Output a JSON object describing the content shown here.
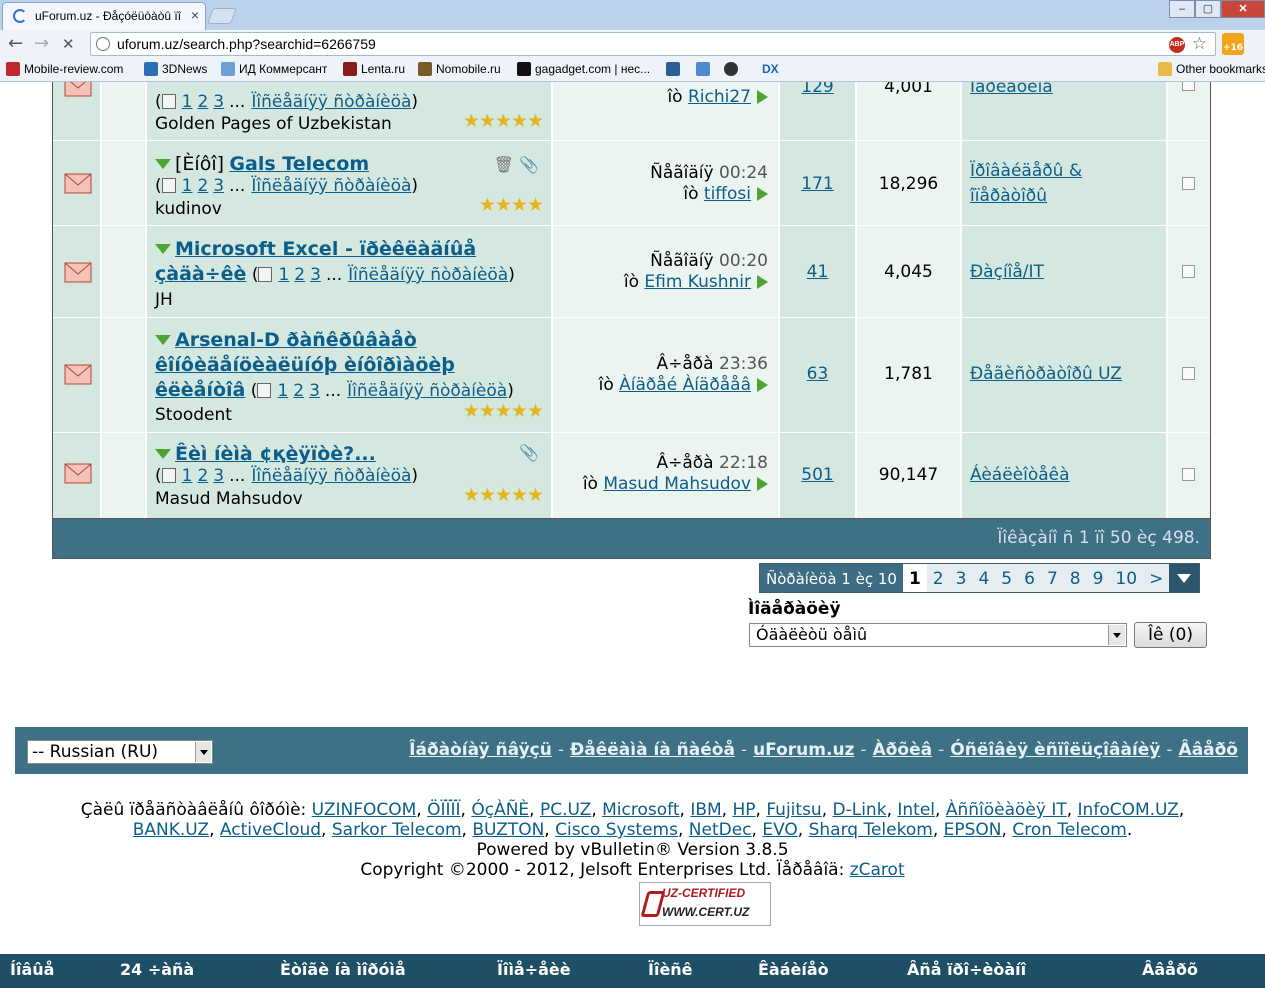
{
  "browser": {
    "tab_title": "uForum.uz - Ðåçóëüòàòû ïî",
    "url": "uforum.uz/search.php?searchid=6266759",
    "ext_badge": "+16",
    "abp_label": "ABP",
    "bookmarks": [
      "Mobile-review.com",
      "3DNews",
      "ИД Коммерсант",
      "Lenta.ru",
      "Nomobile.ru",
      "gagadget.com | нес...",
      "DX",
      "Other bookmarks"
    ]
  },
  "threads": [
    {
      "prefix": "",
      "title": "",
      "pages_prefix": "(",
      "pages": [
        "1",
        "2",
        "3"
      ],
      "ellipsis": "...",
      "last_page": "Ïîñëåäíÿÿ ñòðàíèöà",
      "pages_suffix": ")",
      "starter": "Golden Pages of Uzbekistan",
      "stars": "★★★★★",
      "last_date": "",
      "last_time": "",
      "by": "îò",
      "last_user": "Richi27",
      "replies": "129",
      "views": "4,001",
      "forum": "Ìàðêåòèíã"
    },
    {
      "prefix": "[Èíôî]",
      "title": "Gals Telecom",
      "pages_prefix": "(",
      "pages": [
        "1",
        "2",
        "3"
      ],
      "ellipsis": "...",
      "last_page": "Ïîñëåäíÿÿ ñòðàíèöà",
      "pages_suffix": ")",
      "starter": "kudinov",
      "stars": "★★★★",
      "last_date": "Ñåãîäíÿ",
      "last_time": "00:24",
      "by": "îò",
      "last_user": "tiffosi",
      "replies": "171",
      "views": "18,296",
      "forum_l1": "Ïðîâàéäåðû &",
      "forum_l2": "îïåðàòîðû"
    },
    {
      "title_l1": "Microsoft Excel - ïðèêëàäíûå",
      "title_l2": "çàäà÷êè",
      "pages_prefix": "(",
      "pages": [
        "1",
        "2",
        "3"
      ],
      "ellipsis": "...",
      "last_page": "Ïîñëåäíÿÿ ñòðàíèöà",
      "pages_suffix": ")",
      "starter": "JH",
      "last_date": "Ñåãîäíÿ",
      "last_time": "00:20",
      "by": "îò",
      "last_user": "Efim Kushnir",
      "replies": "41",
      "views": "4,045",
      "forum": "Ðàçíîå/IT"
    },
    {
      "title_l1": "Arsenal-D ðàñêðûâàåò",
      "title_l2": "êîíôèäåíöèàëüíóþ èíôîðìàöèþ",
      "title_l3": "êëèåíòîâ",
      "pages_prefix": "(",
      "pages": [
        "1",
        "2",
        "3"
      ],
      "ellipsis": "...",
      "last_page": "Ïîñëåäíÿÿ ñòðàíèöà",
      "pages_suffix": ")",
      "starter": "Stoodent",
      "stars": "★★★★★",
      "last_date": "Â÷åðà",
      "last_time": "23:36",
      "by": "îò",
      "last_user": "Àíäðåé Àíäðååâ",
      "replies": "63",
      "views": "1,781",
      "forum": "Ðåãèñòðàòîðû UZ"
    },
    {
      "title": "Êèì íèìà ¢қèÿïòè?...",
      "pages_prefix": "(",
      "pages": [
        "1",
        "2",
        "3"
      ],
      "ellipsis": "...",
      "last_page": "Ïîñëåäíÿÿ ñòðàíèöà",
      "pages_suffix": ")",
      "starter": "Masud Mahsudov",
      "stars": "★★★★★",
      "last_date": "Â÷åðà",
      "last_time": "22:18",
      "by": "îò",
      "last_user": "Masud Mahsudov",
      "replies": "501",
      "views": "90,147",
      "forum": "Áèáëèîòåêà"
    }
  ],
  "table_footer": "Ïîêàçàíî ñ 1 ïî 50 èç 498.",
  "pager": {
    "label": "Ñòðàíèöà 1 èç 10",
    "pages": [
      "1",
      "2",
      "3",
      "4",
      "5",
      "6",
      "7",
      "8",
      "9",
      "10",
      ">"
    ]
  },
  "sort": {
    "label": "Ìîäåðàöèÿ",
    "selected": "Óäàëèòü òåìû",
    "button": "Îê (0)"
  },
  "footer": {
    "language": "-- Russian (RU)",
    "links": [
      "Îáðàòíàÿ ñâÿçü",
      "Ðåêëàìà íà ñàéòå",
      "uForum.uz",
      "Àðõèâ",
      "Óñëîâèÿ èñïîëüçîâàíèÿ",
      "Ââåðõ"
    ],
    "sep": "-"
  },
  "credits": {
    "sponsors_label": "Çàëû ïðåäñòàâëåíû ôîðóìè:",
    "sponsors_l1": [
      "UZINFOCOM",
      "ÖÏÏÏÏ",
      "ÓçÀÑÈ",
      "PC.UZ",
      "Microsoft",
      "IBM",
      "HP",
      "Fujitsu",
      "D-Link",
      "Intel",
      "Àññîöèàöèÿ IT",
      "InfoCOM.UZ"
    ],
    "sponsors_l2": [
      "BANK.UZ",
      "ActiveCloud",
      "Sarkor Telecom",
      "BUZTON",
      "Cisco Systems",
      "NetDec",
      "EVO",
      "Sharq Telekom",
      "EPSON",
      "Cron Telecom"
    ],
    "powered": "Powered by vBulletin® Version 3.8.5",
    "copyright": "Copyright ©2000 - 2012, Jelsoft Enterprises Ltd. Ïåðåâîä:",
    "translator": "zCarot",
    "cert_top": "UZ-CERTIFIED",
    "cert_bottom": "WWW.CERT.UZ"
  },
  "bottom_nav": [
    "Íîâûå",
    "24 ÷àñà",
    "Èòîãè íà ìîðóìå",
    "Ïîìå÷åèè",
    "Ïîèñê",
    "Êàáèíåò",
    "Âñå ïðî÷èòàíî",
    "Ââåðõ"
  ]
}
